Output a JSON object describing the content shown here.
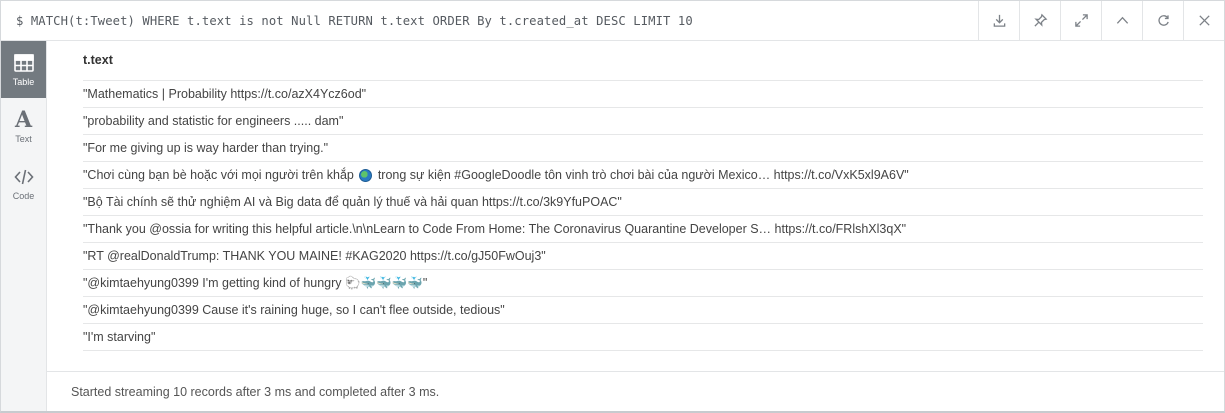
{
  "query": "$ MATCH(t:Tweet) WHERE t.text is not Null RETURN t.text ORDER By t.created_at DESC LIMIT 10",
  "toolbar": [
    {
      "icon": "download-icon"
    },
    {
      "icon": "pin-icon"
    },
    {
      "icon": "expand-icon"
    },
    {
      "icon": "collapse-icon"
    },
    {
      "icon": "rerun-icon"
    },
    {
      "icon": "close-icon"
    }
  ],
  "views": {
    "table": "Table",
    "text": "Text",
    "text_glyph": "A",
    "code": "Code"
  },
  "column": "t.text",
  "rows": [
    "\"Mathematics | Probability https://t.co/azX4Ycz6od\"",
    "\"probability and statistic for engineers ..... dam\"",
    "\"For me giving up is way harder than trying.\"",
    {
      "before": "\"Chơi cùng bạn bè hoặc với mọi người trên khắp ",
      "after": " trong sự kiện #GoogleDoodle tôn vinh trò chơi bài của người Mexico… https://t.co/VxK5xl9A6V\""
    },
    "\"Bộ Tài chính sẽ thử nghiệm AI và Big data để quản lý thuế và hải quan https://t.co/3k9YfuPOAC\"",
    "\"Thank you @ossia for writing this helpful article.\\n\\nLearn to Code From Home: The Coronavirus Quarantine Developer S… https://t.co/FRlshXl3qX\"",
    "\"RT @realDonaldTrump: THANK YOU MAINE! #KAG2020 https://t.co/gJ50FwOuj3\"",
    "\"@kimtaehyung0399 I'm getting kind of hungry 🐑🐳🐳🐳🐳\"",
    "\"@kimtaehyung0399 Cause it's raining huge, so I can't flee outside, tedious\"",
    "\"I'm starving\""
  ],
  "status": "Started streaming 10 records after 3 ms and completed after 3 ms."
}
